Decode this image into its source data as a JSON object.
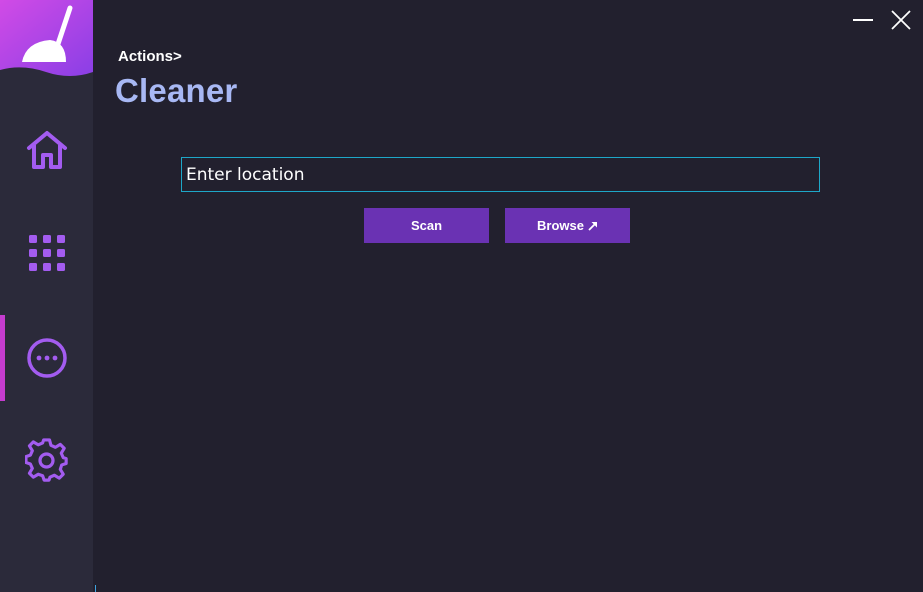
{
  "window": {
    "minimize_icon": "minimize-icon",
    "close_icon": "close-icon"
  },
  "sidebar": {
    "logo_icon": "broom-icon",
    "items": [
      {
        "id": "home",
        "icon": "home-icon",
        "active": false
      },
      {
        "id": "apps",
        "icon": "grid-icon",
        "active": false
      },
      {
        "id": "actions",
        "icon": "more-circle-icon",
        "active": true
      },
      {
        "id": "settings",
        "icon": "gear-icon",
        "active": false
      }
    ]
  },
  "header": {
    "breadcrumb": "Actions>",
    "title": "Cleaner"
  },
  "form": {
    "location_placeholder": "Enter location",
    "location_value": "",
    "scan_label": "Scan",
    "browse_label": "Browse",
    "browse_icon": "arrow-up-right-icon"
  },
  "colors": {
    "background": "#22202e",
    "sidebar": "#2b2a3a",
    "accent_purple": "#6a32b3",
    "icon_purple": "#a35cf0",
    "active_indicator": "#c53ccf",
    "title": "#a8b8f4",
    "input_border": "#1ea7c8"
  }
}
